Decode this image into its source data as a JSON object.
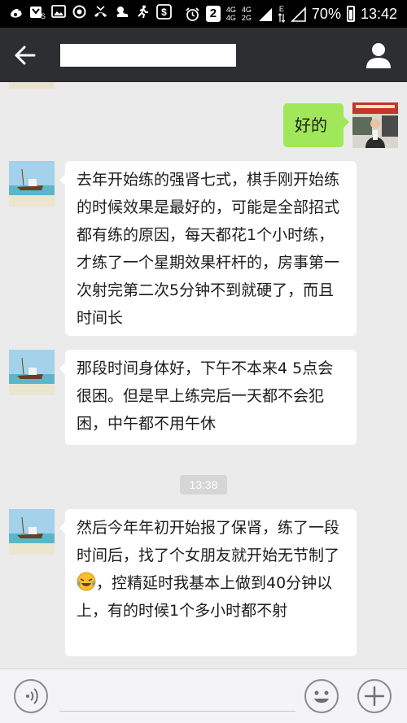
{
  "status_bar": {
    "left_icons": [
      "weibo-icon",
      "s-notification-icon",
      "image-icon",
      "sync-icon",
      "missed-call-icon",
      "weather-icon",
      "running-icon",
      "dollar-icon"
    ],
    "alarm_icon": "alarm-icon",
    "sim_badge": "2",
    "network_top": "4G",
    "network_bottom": "4G",
    "network_bottom2": "2G",
    "data_type": "E",
    "battery_percent": "70%",
    "time": "13:42"
  },
  "header": {
    "back_icon": "back-arrow-icon",
    "title": "",
    "contact_icon": "person-icon"
  },
  "messages": [
    {
      "side": "right",
      "text": "好的"
    },
    {
      "side": "left",
      "text": "去年开始练的强肾七式，棋手刚开始练的时候效果是最好的，可能是全部招式都有练的原因，每天都花1个小时练，才练了一个星期效果杆杆的，房事第一次射完第二次5分钟不到就硬了，而且时间长"
    },
    {
      "side": "left",
      "text": "那段时间身体好，下午不本来4 5点会很困。但是早上练完后一天都不会犯困，中午都不用午休"
    },
    {
      "side": "time",
      "text": "13:38"
    },
    {
      "side": "left",
      "text_before_emoji": "然后今年年初开始报了保肾，练了一段时间后，找了个女朋友就开始无节制了",
      "emoji": "crying-laughing-emoji",
      "text_after_emoji": "，控精延时我基本上做到40分钟以上，有的时候1个多小时都不射"
    }
  ],
  "input_bar": {
    "voice_icon": "voice-icon",
    "placeholder": "",
    "emoji_icon": "smiley-icon",
    "plus_icon": "plus-icon"
  },
  "colors": {
    "status_bar_bg": "#000000",
    "header_bg": "#2d2e31",
    "chat_bg": "#ebebeb",
    "sent_bubble": "#a0e75a",
    "received_bubble": "#ffffff",
    "time_badge": "#d6d6d6"
  }
}
